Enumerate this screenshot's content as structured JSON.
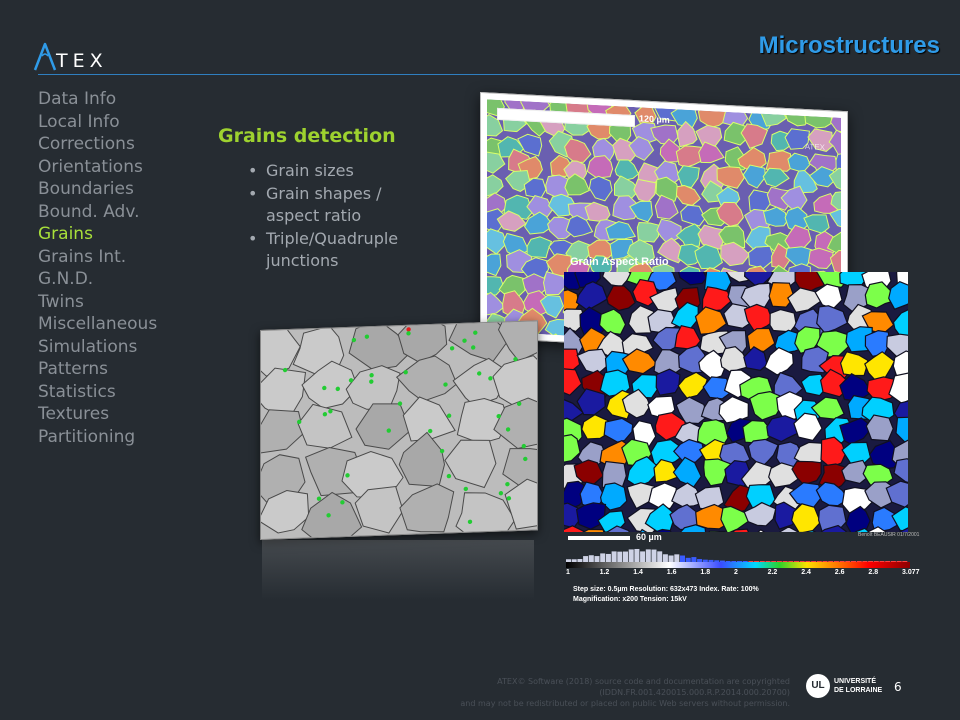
{
  "header": {
    "logo_text": "TEX",
    "title": "Microstructures"
  },
  "nav": {
    "items": [
      {
        "label": "Data Info",
        "active": false
      },
      {
        "label": "Local Info",
        "active": false
      },
      {
        "label": "Corrections",
        "active": false
      },
      {
        "label": "Orientations",
        "active": false
      },
      {
        "label": "Boundaries",
        "active": false
      },
      {
        "label": "Bound. Adv.",
        "active": false
      },
      {
        "label": "Grains",
        "active": true
      },
      {
        "label": "Grains Int.",
        "active": false
      },
      {
        "label": "G.N.D.",
        "active": false
      },
      {
        "label": "Twins",
        "active": false
      },
      {
        "label": "Miscellaneous",
        "active": false
      },
      {
        "label": "Simulations",
        "active": false
      },
      {
        "label": "Patterns",
        "active": false
      },
      {
        "label": "Statistics",
        "active": false
      },
      {
        "label": "Textures",
        "active": false
      },
      {
        "label": "Partitioning",
        "active": false
      }
    ]
  },
  "content": {
    "section_title": "Grains detection",
    "bullets": [
      "Grain sizes",
      "Grain shapes / aspect ratio",
      "Triple/Quadruple junctions"
    ]
  },
  "figures": {
    "orientation_map": {
      "scale_label": "120 µm",
      "watermark": "ATEX"
    },
    "aspect_ratio": {
      "title": "Grain Aspect Ratio",
      "scale_label": "60 µm",
      "credit": "Benoît BEAUSIR 01/7/2001",
      "colorbar_ticks": [
        "1",
        "1.2",
        "1.4",
        "1.6",
        "1.8",
        "2",
        "2.2",
        "2.4",
        "2.6",
        "2.8",
        "3.077"
      ],
      "meta_line1": "Step size: 0.5µm    Resolution: 632x473    Index. Rate: 100%",
      "meta_line2": "Magnification: x200    Tension: 15kV"
    }
  },
  "footer": {
    "copyright_line1": "ATEX© Software (2018) source code and documentation are copyrighted (IDDN.FR.001.420015.000.R.P.2014.000.20700)",
    "copyright_line2": "and may not be redistributed or placed on public Web servers without permission.",
    "university_line1": "UNIVERSITÉ",
    "university_line2": "DE LORRAINE",
    "university_monogram": "UL",
    "page_number": "6"
  },
  "colors": {
    "accent_blue": "#2f9be8",
    "active_green": "#a8e03a",
    "background": "#262c32"
  }
}
